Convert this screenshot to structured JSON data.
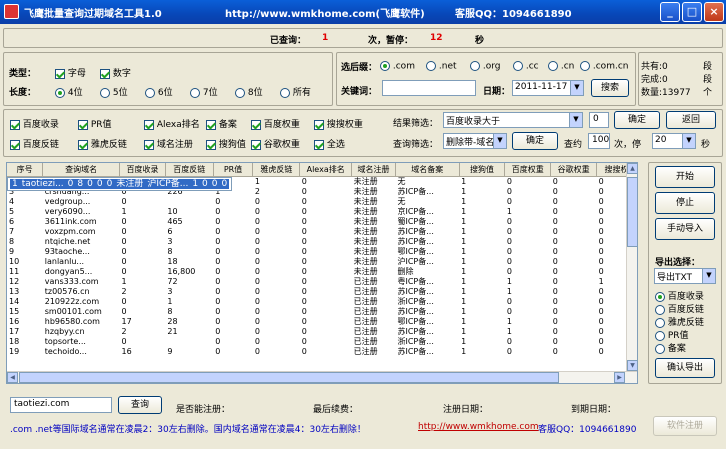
{
  "window": {
    "title": "飞鹰批量查询过期域名工具1.0",
    "url": "http://www.wmkhome.com(飞鹰软件)",
    "qq": "客服QQ：1094661890"
  },
  "status": {
    "queried_label": "已查询：",
    "queried_value": "1",
    "pause_prefix": "次，暂停：",
    "pause_value": "12",
    "pause_suffix": "秒"
  },
  "type_group": {
    "type_label": "类型：",
    "letter": "字母",
    "digit": "数字",
    "length_label": "长度：",
    "lengths": [
      "4位",
      "5位",
      "6位",
      "7位",
      "8位",
      "所有"
    ]
  },
  "suffix_group": {
    "label": "选后缀：",
    "options": [
      ".com",
      ".net",
      ".org",
      ".cc",
      ".cn",
      ".com.cn"
    ],
    "keyword_label": "关键词：",
    "keyword_value": "",
    "date_label": "日期：",
    "date_value": "2011-11-17",
    "search": "搜索"
  },
  "stats": {
    "total": "共有:0",
    "total_unit": "段",
    "done": "完成:0",
    "done_unit": "段",
    "count": "数量:13977",
    "count_unit": "个"
  },
  "checks": [
    {
      "label": "百度收录",
      "on": true
    },
    {
      "label": "PR值",
      "on": true
    },
    {
      "label": "Alexa排名",
      "on": true
    },
    {
      "label": "备案",
      "on": true
    },
    {
      "label": "百度权重",
      "on": true
    },
    {
      "label": "搜搜权重",
      "on": true
    },
    {
      "label": "百度反链",
      "on": true
    },
    {
      "label": "雅虎反链",
      "on": true
    },
    {
      "label": "域名注册",
      "on": true
    },
    {
      "label": "搜狗值",
      "on": true
    },
    {
      "label": "谷歌权重",
      "on": true
    },
    {
      "label": "全选",
      "on": true
    }
  ],
  "filter": {
    "result_label": "结果筛选：",
    "result_value": "百度收录大于",
    "result_num": "0",
    "confirm": "确定",
    "back": "返回",
    "query_label": "查询筛选：",
    "query_value": "删除带-域名",
    "confirm2": "确定",
    "interval_label": "查约",
    "interval_value": "100",
    "pause_label": "次，停",
    "pause_value": "20",
    "sec": "秒"
  },
  "table": {
    "columns": [
      "序号",
      "查询域名",
      "百度收录",
      "百度反链",
      "PR值",
      "雅虎反链",
      "Alexa排名",
      "域名注册",
      "域名备案",
      "搜狗值",
      "百度权重",
      "谷歌权重",
      "搜搜权"
    ],
    "rows": [
      [
        "1",
        "taotiezi...",
        "0",
        "8",
        "0",
        "0",
        "0",
        "未注册",
        "沪ICP备...",
        "1",
        "0",
        "0",
        "0"
      ],
      [
        "2",
        "ustreetm...",
        "0",
        "1",
        "0",
        "1",
        "0",
        "未注册",
        "无",
        "1",
        "0",
        "0",
        "0"
      ],
      [
        "3",
        "crshuang...",
        "0",
        "226",
        "1",
        "2",
        "0",
        "未注册",
        "苏ICP备...",
        "1",
        "0",
        "0",
        "0"
      ],
      [
        "4",
        "vedgroup...",
        "0",
        "",
        "0",
        "0",
        "0",
        "未注册",
        "无",
        "1",
        "0",
        "0",
        "0"
      ],
      [
        "5",
        "very6090...",
        "1",
        "10",
        "0",
        "0",
        "0",
        "未注册",
        "京ICP备...",
        "1",
        "1",
        "0",
        "0"
      ],
      [
        "6",
        "3611ink.com",
        "0",
        "465",
        "0",
        "0",
        "0",
        "未注册",
        "蜀ICP备...",
        "1",
        "0",
        "0",
        "0"
      ],
      [
        "7",
        "voxzpm.com",
        "0",
        "6",
        "0",
        "0",
        "0",
        "未注册",
        "苏ICP备...",
        "1",
        "0",
        "0",
        "0"
      ],
      [
        "8",
        "ntqiche.net",
        "0",
        "3",
        "0",
        "0",
        "0",
        "未注册",
        "苏ICP备...",
        "1",
        "0",
        "0",
        "0"
      ],
      [
        "9",
        "93taoche...",
        "0",
        "8",
        "0",
        "0",
        "0",
        "未注册",
        "鄂ICP备...",
        "1",
        "0",
        "0",
        "0"
      ],
      [
        "10",
        "lanlanlu...",
        "0",
        "18",
        "0",
        "0",
        "0",
        "未注册",
        "沪ICP备...",
        "1",
        "0",
        "0",
        "0"
      ],
      [
        "11",
        "dongyan5...",
        "0",
        "16,800",
        "0",
        "0",
        "0",
        "未注册",
        "删除",
        "1",
        "0",
        "0",
        "0"
      ],
      [
        "12",
        "vans333.com",
        "1",
        "72",
        "0",
        "0",
        "0",
        "已注册",
        "粤ICP备...",
        "1",
        "1",
        "0",
        "1"
      ],
      [
        "13",
        "tz00576.cn",
        "2",
        "3",
        "0",
        "0",
        "0",
        "已注册",
        "苏ICP备...",
        "1",
        "1",
        "0",
        "0"
      ],
      [
        "14",
        "210922z.com",
        "0",
        "1",
        "0",
        "0",
        "0",
        "已注册",
        "浙ICP备...",
        "1",
        "0",
        "0",
        "0"
      ],
      [
        "15",
        "sm00101.com",
        "0",
        "8",
        "0",
        "0",
        "0",
        "已注册",
        "苏ICP备...",
        "1",
        "0",
        "0",
        "0"
      ],
      [
        "16",
        "hb96580.com",
        "17",
        "28",
        "0",
        "0",
        "0",
        "已注册",
        "鄂ICP备...",
        "1",
        "1",
        "0",
        "0"
      ],
      [
        "17",
        "hzqbyy.cn",
        "2",
        "21",
        "0",
        "0",
        "0",
        "已注册",
        "苏ICP备...",
        "1",
        "1",
        "0",
        "0"
      ],
      [
        "18",
        "topsorte...",
        "0",
        "",
        "0",
        "0",
        "0",
        "已注册",
        "浙ICP备...",
        "1",
        "0",
        "0",
        "0"
      ],
      [
        "19",
        "techoido...",
        "16",
        "9",
        "0",
        "0",
        "0",
        "已注册",
        "苏ICP备...",
        "1",
        "0",
        "0",
        "0"
      ]
    ]
  },
  "side": {
    "start": "开始",
    "stop": "停止",
    "manual_import": "手动导入",
    "export_label": "导出选择：",
    "export_format": "导出TXT",
    "export_options": [
      "百度收录",
      "百度反链",
      "雅虎反链",
      "PR值",
      "备案"
    ],
    "confirm_export": "确认导出"
  },
  "bottom": {
    "domain_value": "taotiezi.com",
    "query": "查询",
    "can_register": "是否能注册：",
    "last_renew": "最后续费：",
    "register_date": "注册日期：",
    "expire_date": "到期日期：",
    "notice": ".com .net等国际域名通常在凌晨2：30左右删除。国内域名通常在凌晨4：30左右删除！",
    "link": "http://www.wmkhome.com",
    "qq": "客服QQ：1094661890",
    "register_software": "软件注册"
  }
}
